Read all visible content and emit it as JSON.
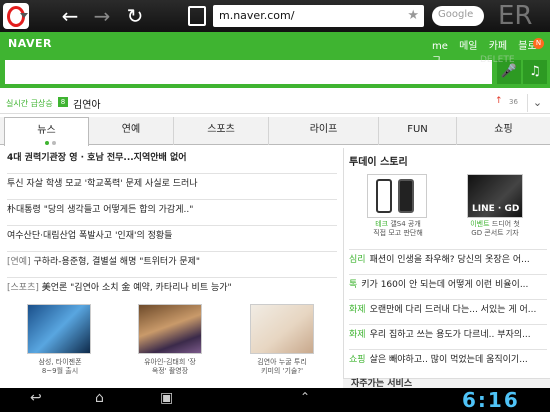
{
  "browser": {
    "url": "m.naver.com/",
    "search_placeholder": "Google"
  },
  "naver": {
    "logo": "NAVER",
    "topnav": [
      "me",
      "메일",
      "카페",
      "블로그"
    ],
    "new_badge": "N",
    "colors": {
      "brand": "#3fb431"
    }
  },
  "trend": {
    "label": "실시간 급상승",
    "rank": "8",
    "word": "김연아",
    "count": "36"
  },
  "tabs": [
    "뉴스",
    "연예",
    "스포츠",
    "라이프",
    "FUN",
    "쇼핑"
  ],
  "news": {
    "rows": [
      {
        "cat": "",
        "text": "4대 권력기관장 영 · 호남 전무...지역안배 없어"
      },
      {
        "cat": "",
        "text": "투신 자살 학생 모교 '학교폭력' 문제 사실로 드러나"
      },
      {
        "cat": "",
        "text": "朴대통령 \"당의 생각들고 어떻게든 합의 가감게..\""
      },
      {
        "cat": "",
        "text": "여수산단·대림산업 폭발사고 '인재'의 정황들"
      },
      {
        "cat": "[연예]",
        "text": " 구하라-용준형, 결별설 해명 \"트위터가 문제\""
      },
      {
        "cat": "[스포츠]",
        "text": " 美언론 \"김연아 소치 金 예약, 카타리나 비트 능가\""
      }
    ],
    "thumbs": [
      {
        "line1": "삼성, 타이젠폰",
        "line2": "8~9월 출시"
      },
      {
        "line1": "유아인-김태희 '장",
        "line2": "옥정' 촬영장"
      },
      {
        "line1": "김연아 누굴 투리",
        "line2": "키미의 '기술?'"
      }
    ]
  },
  "story": {
    "title": "투데이 스토리",
    "items": [
      {
        "tag": "테크",
        "line1": "갤S4 공개",
        "line2": "직접 모고 판단해"
      },
      {
        "tag": "이벤트",
        "line1": "드디어 첫",
        "line2": "GD 콘서트 기자"
      }
    ],
    "lineGD": "LINE · GD",
    "rows": [
      {
        "tag": "심리",
        "text": "패션이 인생을 좌우해? 당신의 옷장은 어..."
      },
      {
        "tag": "톡",
        "text": "키가 160이 안 되는데 어떻게 이런 비율이..."
      },
      {
        "tag": "화제",
        "text": "오랜만에 다리 드러내 다는... 서있는 게 어..."
      },
      {
        "tag": "화제",
        "text": "우리 집하고 쓰는 용도가 다르네.. 부자의..."
      },
      {
        "tag": "쇼핑",
        "text": "살은 빼야하고.. 많이 먹었는데 움직이기..."
      }
    ],
    "footer": "자주가는 서비스"
  },
  "system": {
    "clock": "6:16"
  }
}
